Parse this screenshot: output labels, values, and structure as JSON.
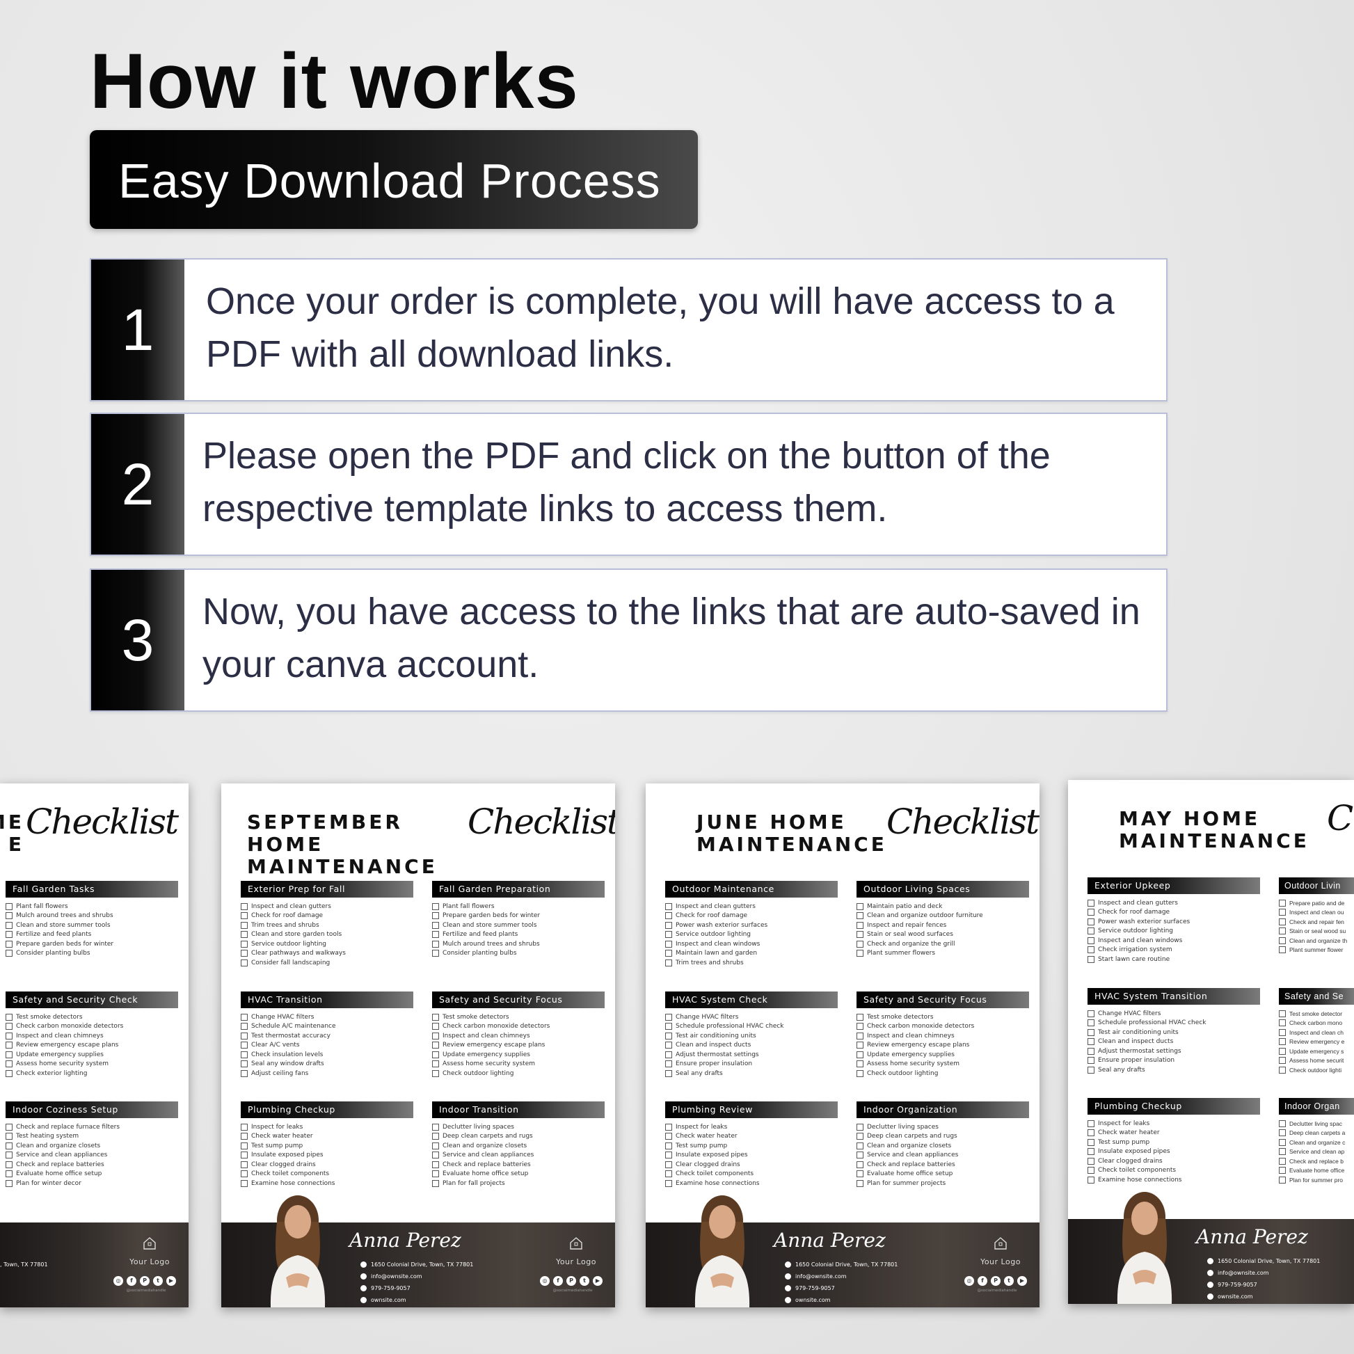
{
  "header": {
    "title": "How it works",
    "badge": "Easy Download Process"
  },
  "steps": [
    {
      "number": "1",
      "text": "Once your order is complete, you will have access to a PDF with all download links."
    },
    {
      "number": "2",
      "text": "Please open the PDF and click on the button of the respective template links to access them."
    },
    {
      "number": "3",
      "text": "Now, you have access to the links that are auto-saved in your canva account."
    }
  ],
  "colors": {
    "accent": "#000000",
    "step_text": "#2b2e45",
    "step_border": "#b9bed8",
    "footer": "#2f2a28"
  },
  "pages": [
    {
      "title": [
        "ME",
        "E"
      ],
      "title_align": "right",
      "script": "Checklist",
      "left": [],
      "right": [
        {
          "heading": "Fall Garden Tasks",
          "items": [
            "Plant fall flowers",
            "Mulch around trees and shrubs",
            "Clean and store summer tools",
            "Fertilize and feed plants",
            "Prepare garden beds for winter",
            "Consider planting bulbs"
          ]
        },
        {
          "heading": "Safety and Security Check",
          "items": [
            "Test smoke detectors",
            "Check carbon monoxide detectors",
            "Inspect and clean chimneys",
            "Review emergency escape plans",
            "Update emergency supplies",
            "Assess home security system",
            "Check exterior lighting"
          ]
        },
        {
          "heading": "Indoor Coziness Setup",
          "items": [
            "Check and replace furnace filters",
            "Test heating system",
            "Clean and organize closets",
            "Service and clean appliances",
            "Check and replace batteries",
            "Evaluate home office setup",
            "Plan for winter decor"
          ]
        }
      ],
      "footer": {
        "address_fragment": ", Town, TX 77801",
        "logo": "Your Logo",
        "social_icons": [
          "instagram-icon",
          "facebook-icon",
          "pinterest-icon",
          "twitter-icon",
          "youtube-icon"
        ],
        "handle": "@socialmediahandle"
      }
    },
    {
      "title": [
        "SEPTEMBER",
        "HOME",
        "MAINTENANCE"
      ],
      "script": "Checklist",
      "left": [
        {
          "heading": "Exterior Prep for Fall",
          "items": [
            "Inspect and clean gutters",
            "Check for roof damage",
            "Trim trees and shrubs",
            "Clean and store garden tools",
            "Service outdoor lighting",
            "Clear pathways and walkways",
            "Consider fall landscaping"
          ]
        },
        {
          "heading": "HVAC Transition",
          "items": [
            "Change HVAC filters",
            "Schedule A/C maintenance",
            "Test thermostat accuracy",
            "Clear A/C vents",
            "Check insulation levels",
            "Seal any window drafts",
            "Adjust ceiling fans"
          ]
        },
        {
          "heading": "Plumbing Checkup",
          "items": [
            "Inspect for leaks",
            "Check water heater",
            "Test sump pump",
            "Insulate exposed pipes",
            "Clear clogged drains",
            "Check toilet components",
            "Examine hose connections"
          ]
        }
      ],
      "right": [
        {
          "heading": "Fall Garden Preparation",
          "items": [
            "Plant fall flowers",
            "Prepare garden beds for winter",
            "Clean and store summer tools",
            "Fertilize and feed plants",
            "Mulch around trees and shrubs",
            "Consider planting bulbs"
          ]
        },
        {
          "heading": "Safety and Security Focus",
          "items": [
            "Test smoke detectors",
            "Check carbon monoxide detectors",
            "Inspect and clean chimneys",
            "Review emergency escape plans",
            "Update emergency supplies",
            "Assess home security system",
            "Check outdoor lighting"
          ]
        },
        {
          "heading": "Indoor Transition",
          "items": [
            "Declutter living spaces",
            "Deep clean carpets and rugs",
            "Clean and organize closets",
            "Service and clean appliances",
            "Check and replace batteries",
            "Evaluate home office setup",
            "Plan for fall projects"
          ]
        }
      ],
      "footer": {
        "signature": "Anna Perez",
        "address": "1650 Colonial Drive, Town, TX 77801",
        "email": "info@ownsite.com",
        "phone": "979-759-9057",
        "website": "ownsite.com",
        "logo": "Your Logo",
        "social_icons": [
          "instagram-icon",
          "facebook-icon",
          "pinterest-icon",
          "twitter-icon",
          "youtube-icon"
        ],
        "handle": "@socialmediahandle"
      }
    },
    {
      "title": [
        "JUNE HOME",
        "MAINTENANCE"
      ],
      "script": "Checklist",
      "left": [
        {
          "heading": "Outdoor Maintenance",
          "items": [
            "Inspect and clean gutters",
            "Check for roof damage",
            "Power wash exterior surfaces",
            "Service outdoor lighting",
            "Inspect and clean windows",
            "Maintain lawn and garden",
            "Trim trees and shrubs"
          ]
        },
        {
          "heading": "HVAC System Check",
          "items": [
            "Change HVAC filters",
            "Schedule professional HVAC check",
            "Test air conditioning units",
            "Clean and inspect ducts",
            "Adjust thermostat settings",
            "Ensure proper insulation",
            "Seal any drafts"
          ]
        },
        {
          "heading": "Plumbing Review",
          "items": [
            "Inspect for leaks",
            "Check water heater",
            "Test sump pump",
            "Insulate exposed pipes",
            "Clear clogged drains",
            "Check toilet components",
            "Examine hose connections"
          ]
        }
      ],
      "right": [
        {
          "heading": "Outdoor Living Spaces",
          "items": [
            "Maintain patio and deck",
            "Clean and organize outdoor furniture",
            "Inspect and repair fences",
            "Stain or seal wood surfaces",
            "Check and organize the grill",
            "Plant summer flowers"
          ]
        },
        {
          "heading": "Safety and Security Focus",
          "items": [
            "Test smoke detectors",
            "Check carbon monoxide detectors",
            "Inspect and clean chimneys",
            "Review emergency escape plans",
            "Update emergency supplies",
            "Assess home security system",
            "Check outdoor lighting"
          ]
        },
        {
          "heading": "Indoor Organization",
          "items": [
            "Declutter living spaces",
            "Deep clean carpets and rugs",
            "Clean and organize closets",
            "Service and clean appliances",
            "Check and replace batteries",
            "Evaluate home office setup",
            "Plan for summer projects"
          ]
        }
      ],
      "footer": {
        "signature": "Anna Perez",
        "address": "1650 Colonial Drive, Town, TX 77801",
        "email": "info@ownsite.com",
        "phone": "979-759-9057",
        "website": "ownsite.com",
        "logo": "Your Logo",
        "social_icons": [
          "instagram-icon",
          "facebook-icon",
          "pinterest-icon",
          "twitter-icon",
          "youtube-icon"
        ],
        "handle": "@socialmediahandle"
      }
    },
    {
      "title": [
        "MAY HOME",
        "MAINTENANCE"
      ],
      "script": "C",
      "left": [
        {
          "heading": "Exterior Upkeep",
          "items": [
            "Inspect and clean gutters",
            "Check for roof damage",
            "Power wash exterior surfaces",
            "Service outdoor lighting",
            "Inspect and clean windows",
            "Check irrigation system",
            "Start lawn care routine"
          ]
        },
        {
          "heading": "HVAC System Transition",
          "items": [
            "Change HVAC filters",
            "Schedule professional HVAC check",
            "Test air conditioning units",
            "Clean and inspect ducts",
            "Adjust thermostat settings",
            "Ensure proper insulation",
            "Seal any drafts"
          ]
        },
        {
          "heading": "Plumbing Checkup",
          "items": [
            "Inspect for leaks",
            "Check water heater",
            "Test sump pump",
            "Insulate exposed pipes",
            "Clear clogged drains",
            "Check toilet components",
            "Examine hose connections"
          ]
        }
      ],
      "right": [
        {
          "heading": "Outdoor Livin",
          "items": [
            "Prepare patio and de",
            "Inspect and clean ou",
            "Check and repair fen",
            "Stain or seal wood su",
            "Clean and organize th",
            "Plant summer flower"
          ]
        },
        {
          "heading": "Safety and Se",
          "items": [
            "Test smoke detector",
            "Check carbon mono",
            "Inspect and clean ch",
            "Review emergency e",
            "Update emergency s",
            "Assess home securit",
            "Check outdoor lighti"
          ]
        },
        {
          "heading": "Indoor Organ",
          "items": [
            "Declutter living spac",
            "Deep clean carpets a",
            "Clean and organize c",
            "Service and clean ap",
            "Check and replace b",
            "Evaluate home office",
            "Plan for summer pro"
          ]
        }
      ],
      "footer": {
        "signature": "Anna Perez",
        "address": "1650 Colonial Drive, Town, TX 77801",
        "email": "info@ownsite.com",
        "phone": "979-759-9057",
        "website": "ownsite.com"
      }
    }
  ]
}
